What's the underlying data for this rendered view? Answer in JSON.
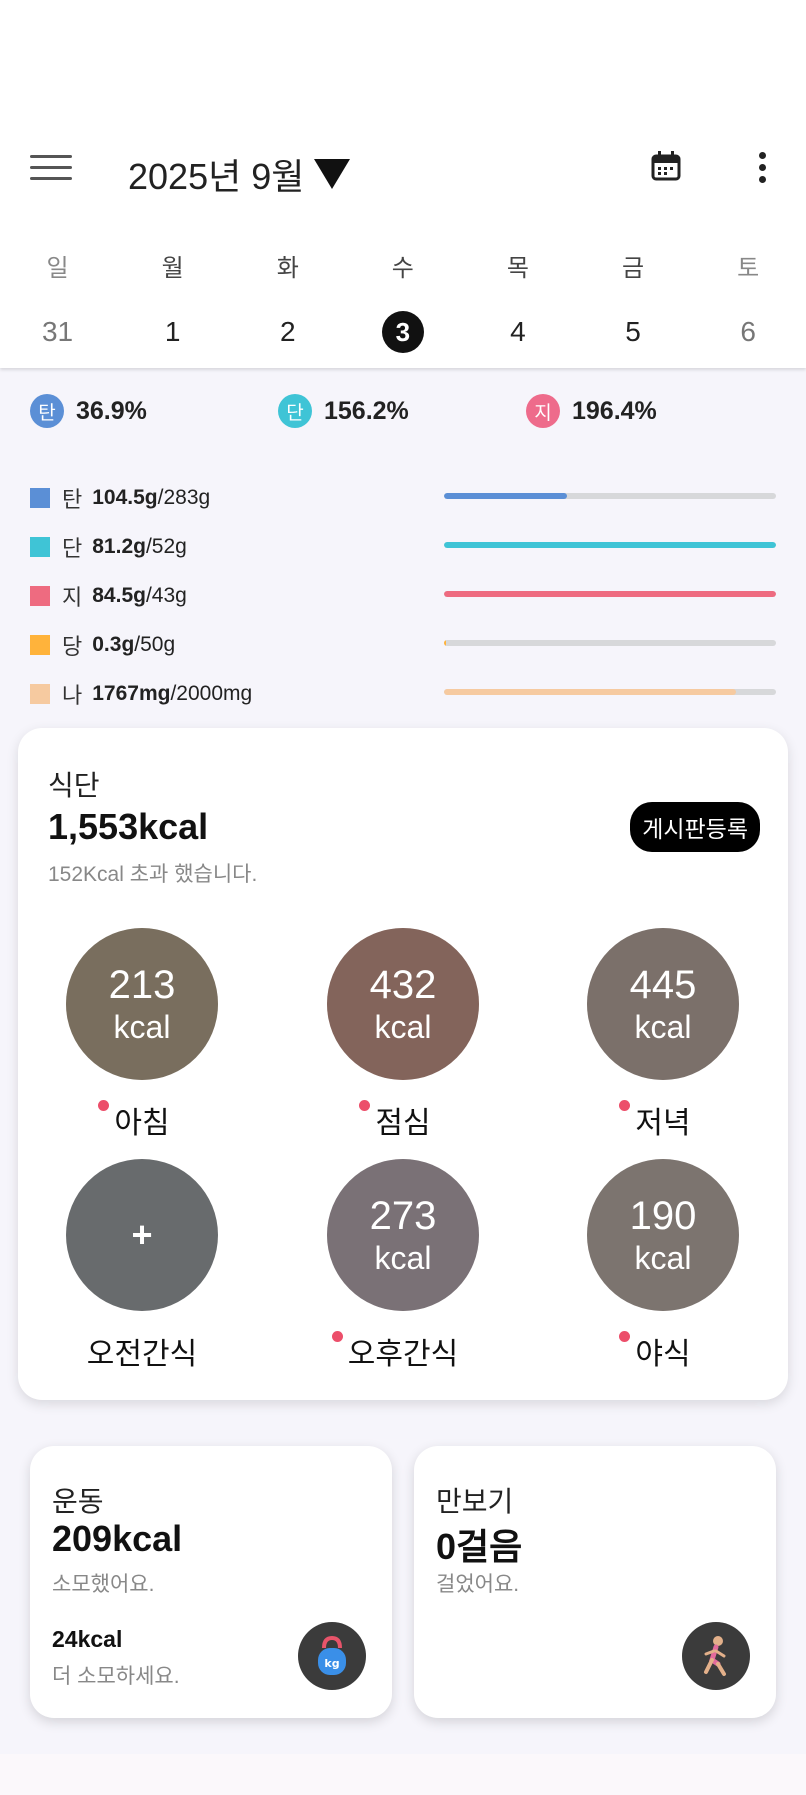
{
  "header": {
    "month_label": "2025년 9월",
    "icons": {
      "menu": "hamburger-menu-icon",
      "calendar": "calendar-icon",
      "more": "more-vertical-icon"
    }
  },
  "week": {
    "days": [
      {
        "dow": "일",
        "date": "31"
      },
      {
        "dow": "월",
        "date": "1"
      },
      {
        "dow": "화",
        "date": "2"
      },
      {
        "dow": "수",
        "date": "3"
      },
      {
        "dow": "목",
        "date": "4"
      },
      {
        "dow": "금",
        "date": "5"
      },
      {
        "dow": "토",
        "date": "6"
      }
    ],
    "selected_index": 3
  },
  "ratios": [
    {
      "badge": "탄",
      "pct": "36.9%",
      "color": "#5b8fd6"
    },
    {
      "badge": "단",
      "pct": "156.2%",
      "color": "#3fc4d6"
    },
    {
      "badge": "지",
      "pct": "196.4%",
      "color": "#ee6b8b"
    }
  ],
  "nutrients": [
    {
      "name": "탄",
      "amount": "104.5g",
      "goal": "/283g",
      "color": "#5b8fd6",
      "fill_fraction": 0.37
    },
    {
      "name": "단",
      "amount": "81.2g",
      "goal": "/52g",
      "color": "#3fc4d6",
      "fill_fraction": 1.0
    },
    {
      "name": "지",
      "amount": "84.5g",
      "goal": "/43g",
      "color": "#ee6b80",
      "fill_fraction": 1.0
    },
    {
      "name": "당",
      "amount": "0.3g",
      "goal": "/50g",
      "color": "#ffb33b",
      "fill_fraction": 0.006
    },
    {
      "name": "나",
      "amount": "1767mg",
      "goal": "/2000mg",
      "color": "#f6caa0",
      "fill_fraction": 0.88
    }
  ],
  "diet": {
    "label": "식단",
    "total": "1,553kcal",
    "note": "152Kcal 초과 했습니다.",
    "board_button": "게시판등록",
    "meals": [
      {
        "name": "아침",
        "kcal": "213",
        "unit": "kcal",
        "recorded": true,
        "bg": "#8a7a62"
      },
      {
        "name": "점심",
        "kcal": "432",
        "unit": "kcal",
        "recorded": true,
        "bg": "#9a6a5c"
      },
      {
        "name": "저녁",
        "kcal": "445",
        "unit": "kcal",
        "recorded": true,
        "bg": "#8e7d74"
      },
      {
        "name": "오전간식",
        "kcal": "",
        "unit": "",
        "recorded": false,
        "plus": "+"
      },
      {
        "name": "오후간식",
        "kcal": "273",
        "unit": "kcal",
        "recorded": true,
        "bg": "#8c7f86"
      },
      {
        "name": "야식",
        "kcal": "190",
        "unit": "kcal",
        "recorded": true,
        "bg": "#8f837c"
      }
    ]
  },
  "exercise": {
    "title": "운동",
    "value": "209kcal",
    "sub": "소모했어요.",
    "remaining": "24kcal",
    "remaining_sub": "더 소모하세요.",
    "icon": "kettlebell-icon"
  },
  "pedometer": {
    "title": "만보기",
    "value": "0걸음",
    "sub": "걸었어요.",
    "icon": "running-person-icon"
  }
}
